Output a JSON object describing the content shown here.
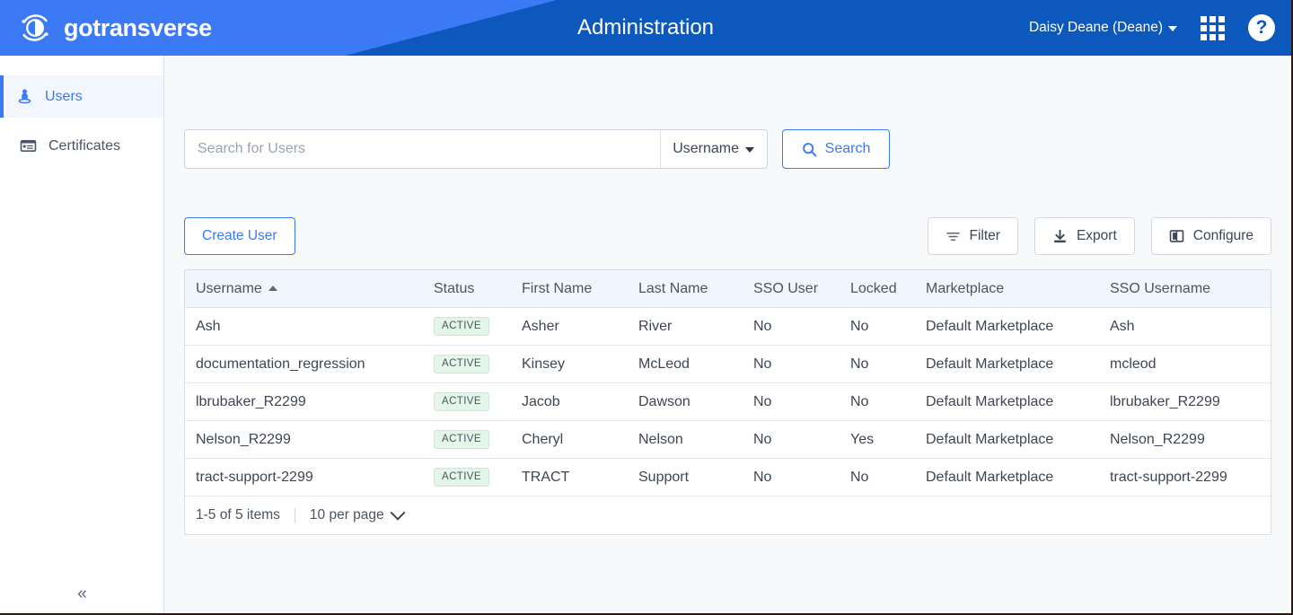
{
  "header": {
    "brand_name": "gotransverse",
    "logo_icon": "gotransverse-circle-logo",
    "title": "Administration",
    "user_menu_label": "Daisy Deane (Deane)",
    "apps_icon": "grid-apps-icon",
    "help_icon": "help-circle-icon",
    "accent_light": "#3c79f5",
    "accent_dark": "#0d58bd"
  },
  "sidebar": {
    "items": [
      {
        "label": "Users",
        "icon": "user-icon",
        "active": true
      },
      {
        "label": "Certificates",
        "icon": "certificate-list-icon",
        "active": false
      }
    ],
    "collapse_icon": "chevrons-left-icon",
    "collapse_glyph": "«"
  },
  "search": {
    "placeholder": "Search for Users",
    "value": "",
    "scope_label": "Username",
    "scope_caret_icon": "caret-down-icon",
    "button_label": "Search",
    "button_icon": "search-icon"
  },
  "toolbar": {
    "create_label": "Create User",
    "filter_label": "Filter",
    "filter_icon": "filter-icon",
    "export_label": "Export",
    "export_icon": "download-icon",
    "configure_label": "Configure",
    "configure_icon": "columns-icon"
  },
  "table": {
    "sort_column": "Username",
    "sort_direction": "asc",
    "sort_icon": "caret-up-icon",
    "columns": [
      "Username",
      "Status",
      "First Name",
      "Last Name",
      "SSO User",
      "Locked",
      "Marketplace",
      "SSO Username"
    ],
    "rows": [
      {
        "username": "Ash",
        "status": "ACTIVE",
        "first_name": "Asher",
        "last_name": "River",
        "sso_user": "No",
        "locked": "No",
        "marketplace": "Default Marketplace",
        "sso_username": "Ash"
      },
      {
        "username": "documentation_regression",
        "status": "ACTIVE",
        "first_name": "Kinsey",
        "last_name": "McLeod",
        "sso_user": "No",
        "locked": "No",
        "marketplace": "Default Marketplace",
        "sso_username": "mcleod"
      },
      {
        "username": "lbrubaker_R2299",
        "status": "ACTIVE",
        "first_name": "Jacob",
        "last_name": "Dawson",
        "sso_user": "No",
        "locked": "No",
        "marketplace": "Default Marketplace",
        "sso_username": "lbrubaker_R2299"
      },
      {
        "username": "Nelson_R2299",
        "status": "ACTIVE",
        "first_name": "Cheryl",
        "last_name": "Nelson",
        "sso_user": "No",
        "locked": "Yes",
        "marketplace": "Default Marketplace",
        "sso_username": "Nelson_R2299"
      },
      {
        "username": "tract-support-2299",
        "status": "ACTIVE",
        "first_name": "TRACT",
        "last_name": "Support",
        "sso_user": "No",
        "locked": "No",
        "marketplace": "Default Marketplace",
        "sso_username": "tract-support-2299"
      }
    ],
    "footer": {
      "items_range": "1-5 of 5 items",
      "per_page_label": "10 per page",
      "per_page_icon": "chevron-down-icon"
    },
    "status_badge_bg": "#e4f5e9",
    "status_badge_border": "#cbe8d5"
  }
}
